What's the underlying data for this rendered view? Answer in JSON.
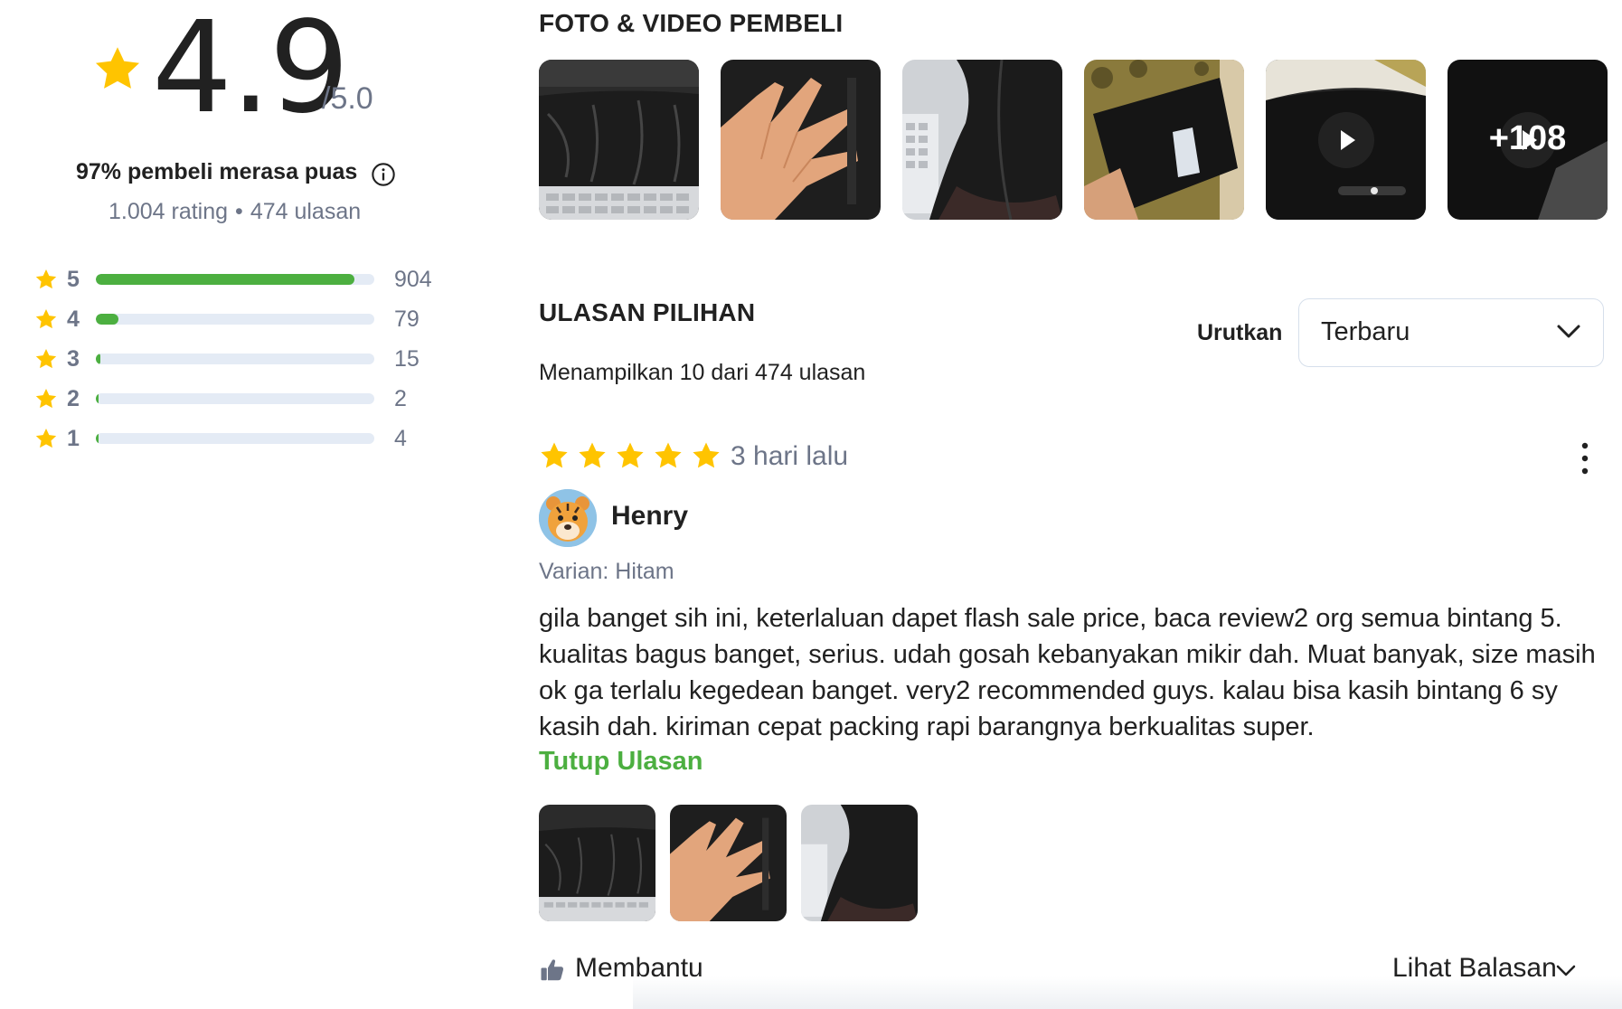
{
  "summary": {
    "score": "4.9",
    "score_max": "/5.0",
    "satisfied_text": "97% pembeli merasa puas",
    "rating_count": "1.004 rating",
    "separator": "•",
    "review_count": "474 ulasan",
    "distribution": [
      {
        "stars": "5",
        "count": "904",
        "fraction": 0.93
      },
      {
        "stars": "4",
        "count": "79",
        "fraction": 0.08
      },
      {
        "stars": "3",
        "count": "15",
        "fraction": 0.015
      },
      {
        "stars": "2",
        "count": "2",
        "fraction": 0.003
      },
      {
        "stars": "1",
        "count": "4",
        "fraction": 0.005
      }
    ]
  },
  "media": {
    "title": "FOTO & VIDEO PEMBELI",
    "more_label": "+108"
  },
  "reviews_section": {
    "title": "ULASAN PILIHAN",
    "showing_text": "Menampilkan 10 dari 474 ulasan",
    "sort_label": "Urutkan",
    "sort_value": "Terbaru"
  },
  "review": {
    "rating": 5,
    "time": "3 hari lalu",
    "reviewer": "Henry",
    "variant": "Varian: Hitam",
    "text": "gila banget sih ini, keterlaluan dapet flash sale price, baca review2 org semua bintang 5. kualitas bagus banget, serius. udah gosah kebanyakan mikir dah. Muat banyak, size masih ok ga terlalu kegedean banget. very2 recommended guys. kalau bisa kasih bintang 6 sy kasih dah. kiriman cepat packing rapi barangnya berkualitas super.",
    "collapse_label": "Tutup Ulasan",
    "helpful_label": "Membantu",
    "replies_label": "Lihat Balasan"
  },
  "colors": {
    "accent_green": "#4caf40",
    "star_yellow": "#ffc400",
    "muted_text": "#6d7588",
    "bar_track": "#e4ebf5"
  },
  "icons": [
    "star-icon",
    "info-icon",
    "play-icon",
    "chevron-down-icon",
    "kebab-menu-icon",
    "thumbs-up-icon"
  ]
}
